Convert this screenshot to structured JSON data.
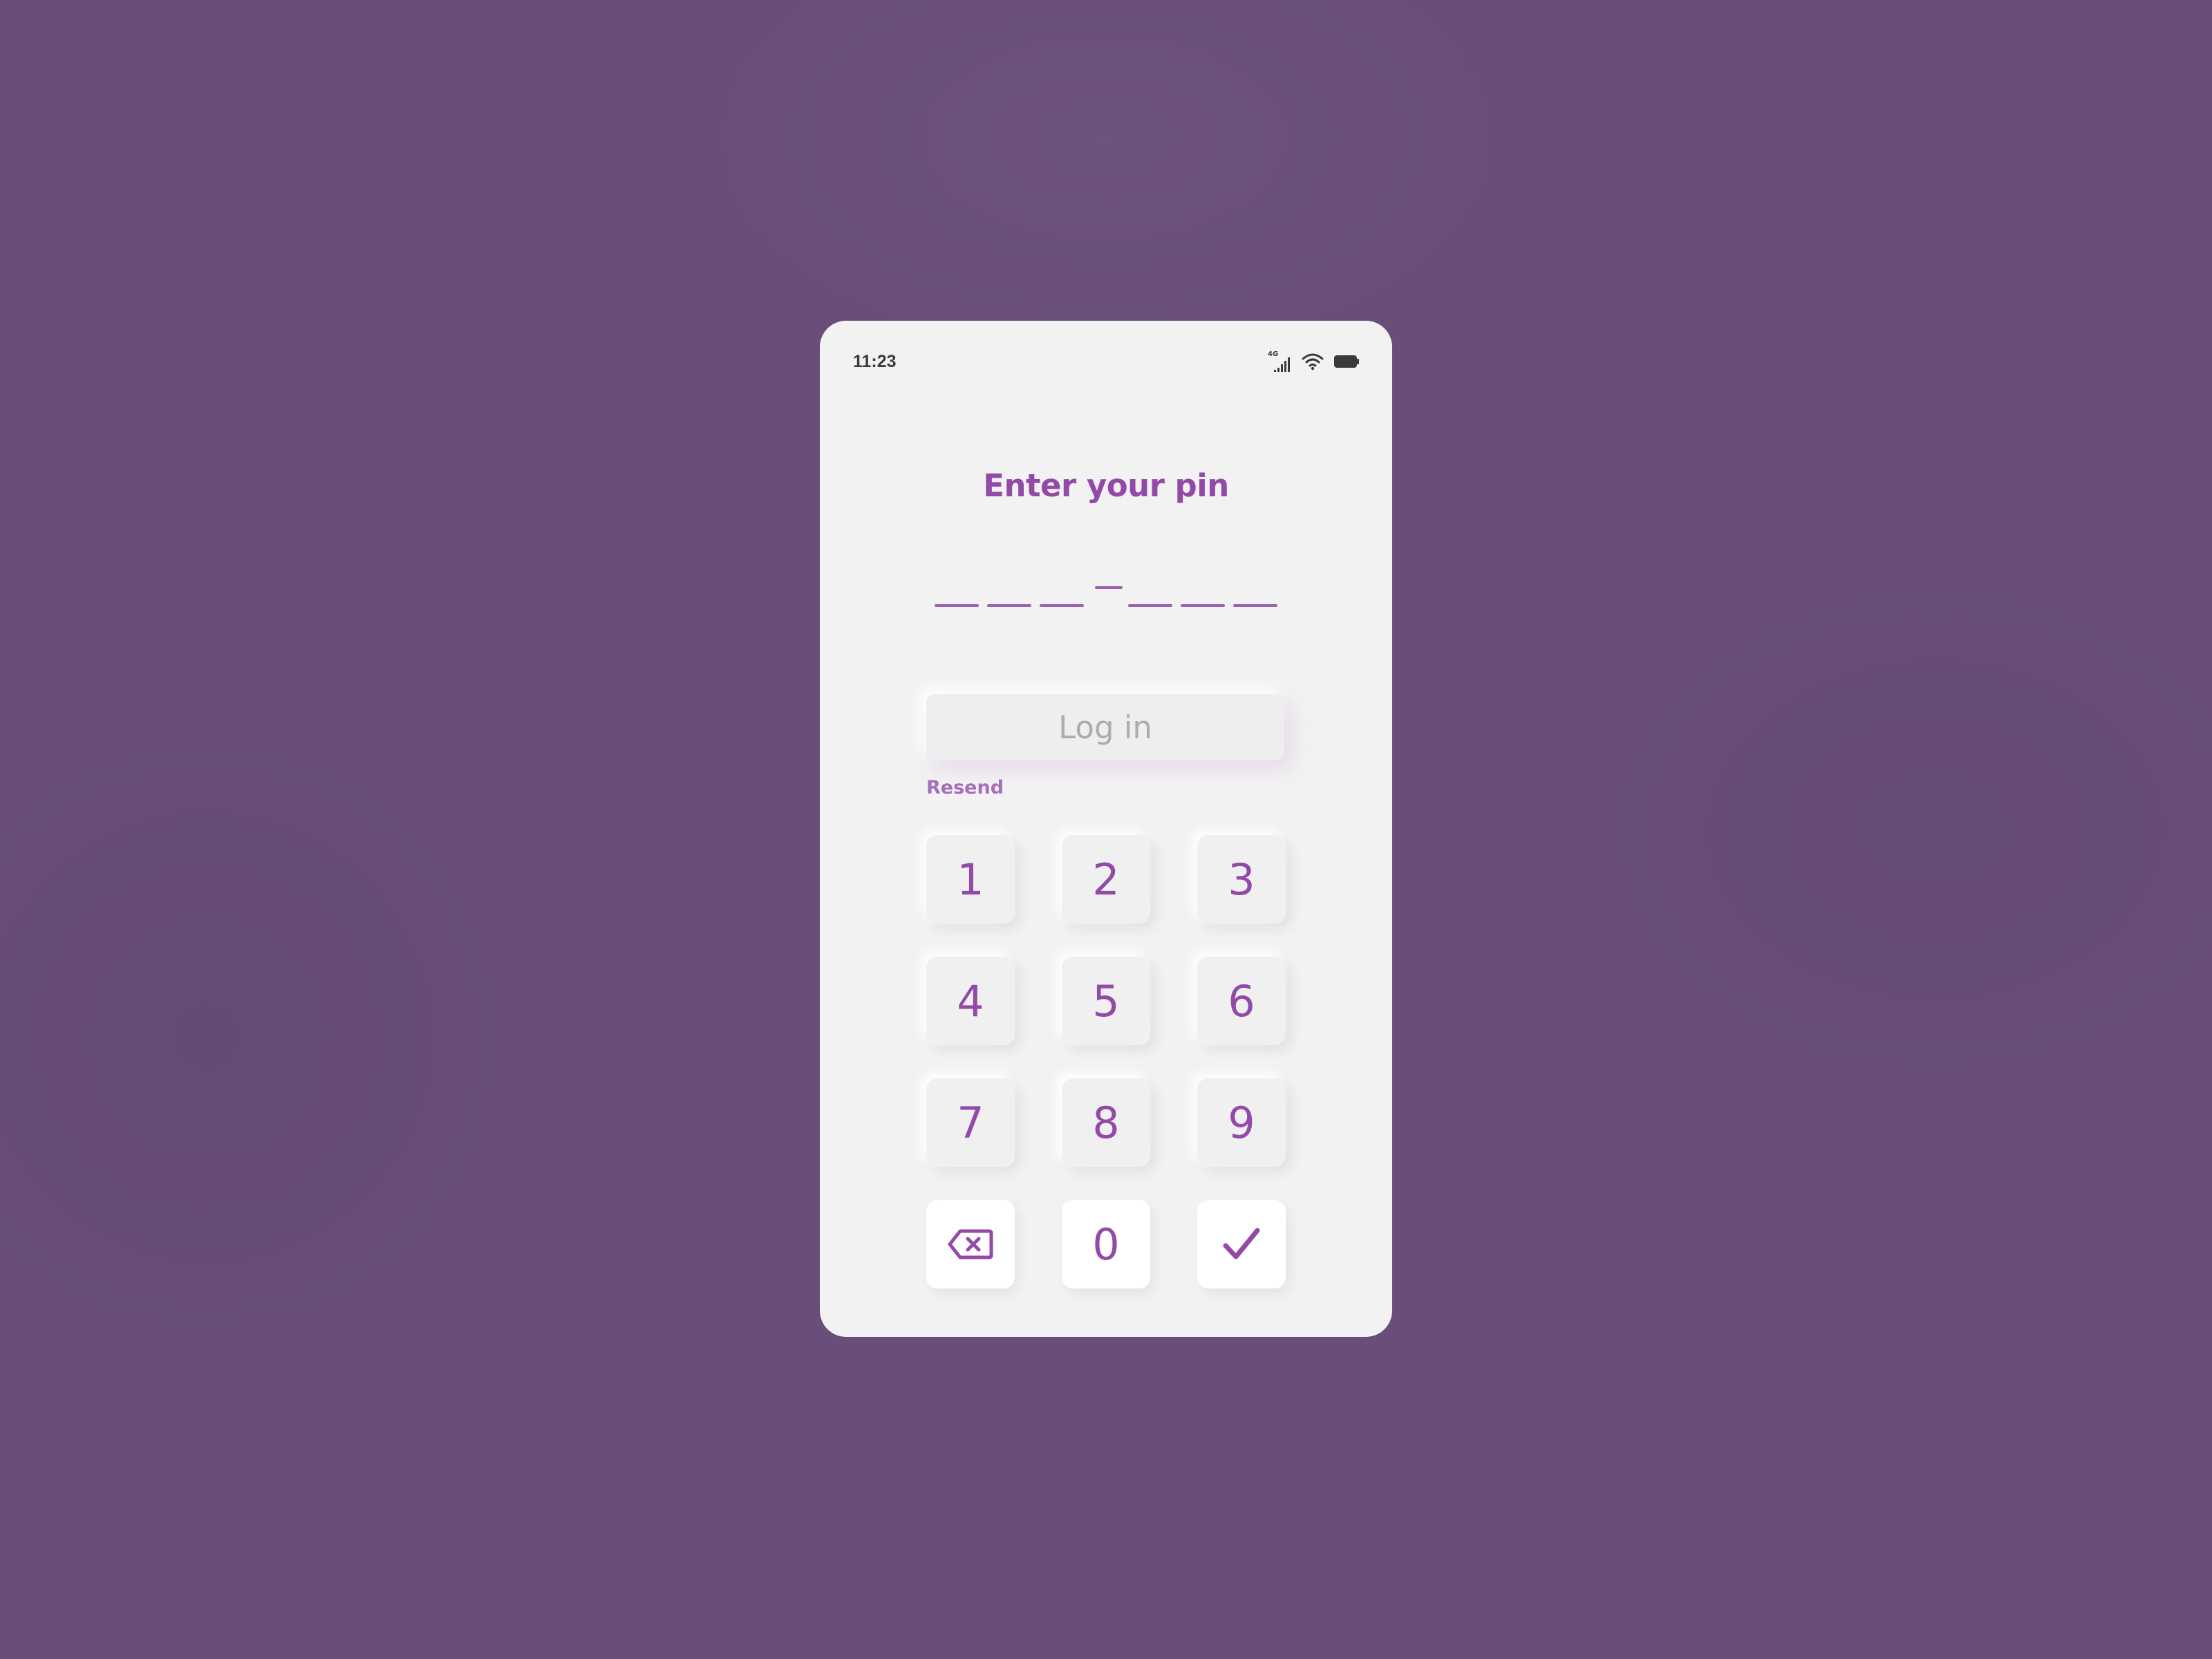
{
  "status_bar": {
    "time": "11:23",
    "network_label": "4G",
    "icons": [
      "signal-icon",
      "wifi-icon",
      "battery-icon"
    ]
  },
  "screen": {
    "title": "Enter your pin",
    "pin_length": 6,
    "pin_entered": 0
  },
  "actions": {
    "login_label": "Log in",
    "resend_label": "Resend"
  },
  "keypad": {
    "keys": [
      "1",
      "2",
      "3",
      "4",
      "5",
      "6",
      "7",
      "8",
      "9",
      "0"
    ],
    "backspace_icon": "backspace-icon",
    "confirm_icon": "checkmark-icon"
  },
  "colors": {
    "background": "#684e78",
    "card": "#f2f2f2",
    "accent": "#9349a8",
    "accent_light": "#a56fba",
    "disabled_text": "#acacac"
  }
}
